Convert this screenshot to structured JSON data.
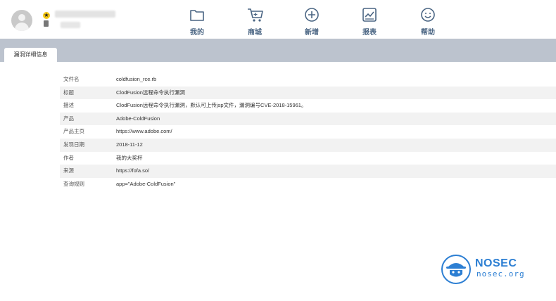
{
  "nav": [
    {
      "label": "我的",
      "icon": "folder-icon"
    },
    {
      "label": "商城",
      "icon": "cart-icon"
    },
    {
      "label": "新增",
      "icon": "plus-circle-icon"
    },
    {
      "label": "报表",
      "icon": "chart-icon"
    },
    {
      "label": "帮助",
      "icon": "smile-icon"
    }
  ],
  "tab": {
    "label": "漏洞详细信息"
  },
  "details": [
    {
      "key": "文件名",
      "value": "coldfusion_rce.rb"
    },
    {
      "key": "标题",
      "value": "ClodFusion远程命令执行漏洞"
    },
    {
      "key": "描述",
      "value": "ClodFusion远程命令执行漏洞，默认可上传jsp文件，漏洞编号CVE-2018-15961。"
    },
    {
      "key": "产品",
      "value": "Adobe-ColdFusion"
    },
    {
      "key": "产品主页",
      "value": "https://www.adobe.com/"
    },
    {
      "key": "发现日期",
      "value": "2018-11-12"
    },
    {
      "key": "作者",
      "value": "我的大奖杯"
    },
    {
      "key": "来源",
      "value": "https://fofa.so/"
    },
    {
      "key": "查询规则",
      "value": "app=\"Adobe-ColdFusion\""
    }
  ],
  "logo": {
    "name": "NOSEC",
    "url": "nosec.org"
  },
  "colors": {
    "nav_text": "#4a6583",
    "tabbar": "#bcc3ce",
    "brand": "#2d7fd3"
  }
}
